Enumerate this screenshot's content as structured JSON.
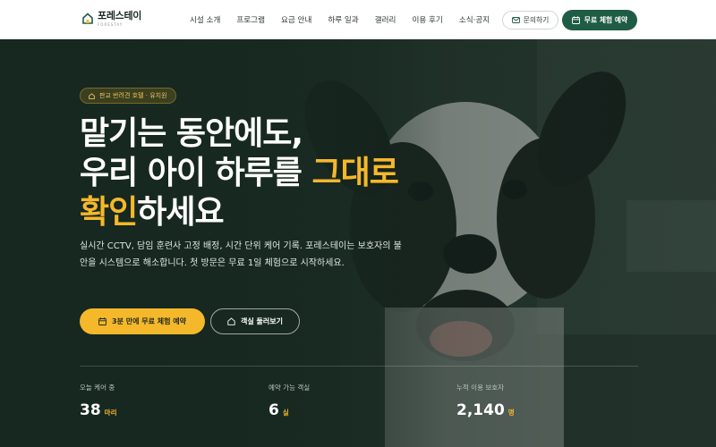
{
  "header": {
    "logo_name": "포레스테이",
    "logo_sub": "FORESTAY",
    "nav": [
      "시설 소개",
      "프로그램",
      "요금 안내",
      "하루 일과",
      "갤러리",
      "이용 후기",
      "소식·공지"
    ],
    "contact_label": "문의하기",
    "reserve_label": "무료 체험 예약"
  },
  "hero": {
    "badge": "판교 반려견 호텔 · 유치원",
    "headline_line1": "맡기는 동안에도,",
    "headline_line2_a": "우리 아이 하루를 ",
    "headline_line2_b": "그대로",
    "headline_line3_a": "확인",
    "headline_line3_b": "하세요",
    "description": "실시간 CCTV, 담임 훈련사 고정 배정, 시간 단위 케어 기록. 포레스테이는 보호자의 불안을 시스템으로 해소합니다. 첫 방문은 무료 1일 체험으로 시작하세요.",
    "cta_primary": "3분 만에 무료 체험 예약",
    "cta_secondary": "객실 둘러보기"
  },
  "stats": [
    {
      "label": "오늘 케어 중",
      "value": "38",
      "unit": "마리"
    },
    {
      "label": "예약 가능 객실",
      "value": "6",
      "unit": "실"
    },
    {
      "label": "누적 이용 보호자",
      "value": "2,140",
      "unit": "명"
    }
  ],
  "colors": {
    "brand_green": "#1f5c46",
    "accent_yellow": "#f5b82a",
    "hero_overlay": "#162820"
  }
}
